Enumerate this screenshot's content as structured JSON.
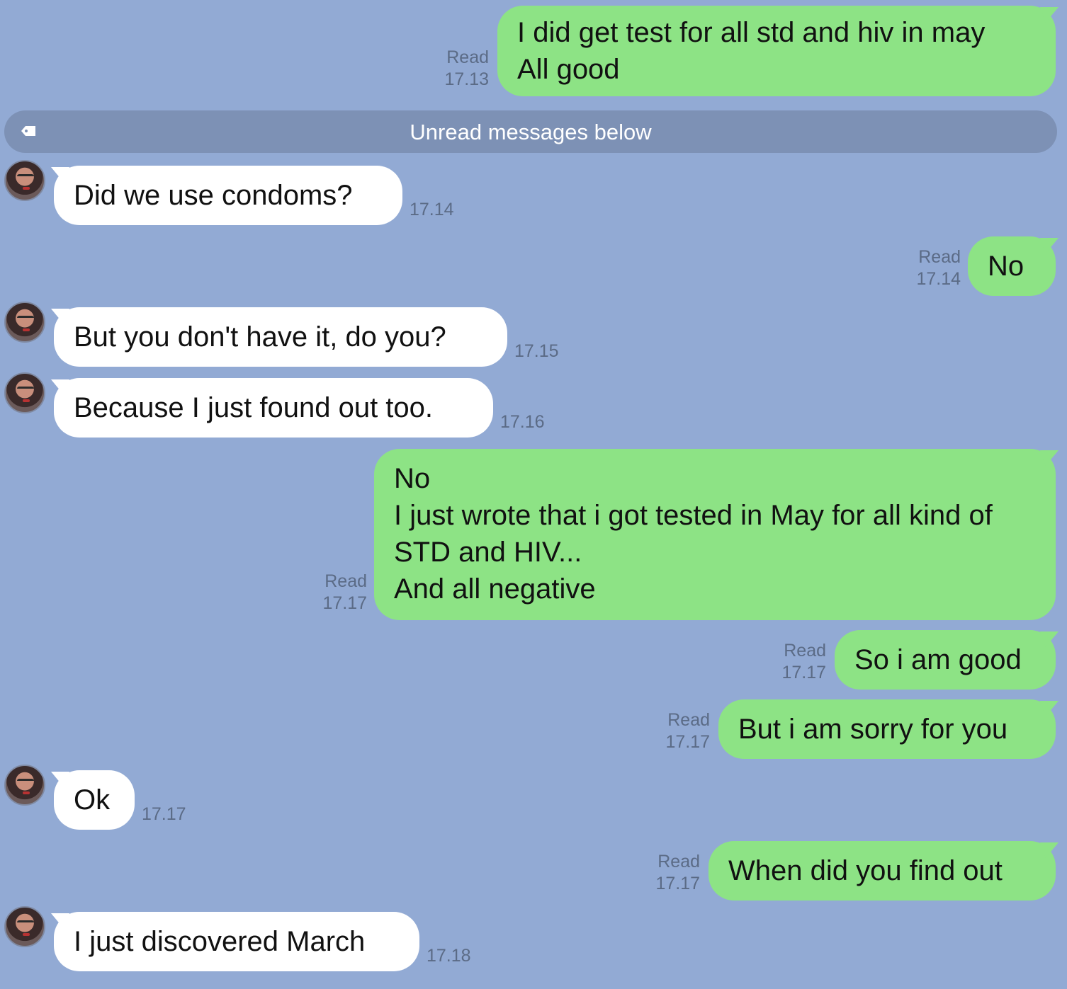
{
  "divider": {
    "label": "Unread messages below",
    "icon": "tag-icon"
  },
  "messages": [
    {
      "dir": "out",
      "text": "I did get test for all std and hiv in may\nAll good",
      "read": "Read",
      "time": "17.13"
    },
    {
      "dir": "in",
      "text": "Did we use condoms?",
      "time": "17.14"
    },
    {
      "dir": "out",
      "text": "No",
      "read": "Read",
      "time": "17.14"
    },
    {
      "dir": "in",
      "text": "But you don't have it, do you?",
      "time": "17.15"
    },
    {
      "dir": "in",
      "text": "Because I just found out too.",
      "time": "17.16"
    },
    {
      "dir": "out",
      "text": " No\nI just wrote that i got tested in May for all kind of STD and HIV...\nAnd all negative",
      "read": "Read",
      "time": "17.17"
    },
    {
      "dir": "out",
      "text": "So i am good",
      "read": "Read",
      "time": "17.17"
    },
    {
      "dir": "out",
      "text": "But i am sorry for you",
      "read": "Read",
      "time": "17.17"
    },
    {
      "dir": "in",
      "text": "Ok",
      "time": "17.17"
    },
    {
      "dir": "out",
      "text": "When did you find out",
      "read": "Read",
      "time": "17.17"
    },
    {
      "dir": "in",
      "text": "I just discovered March",
      "time": "17.18"
    }
  ]
}
